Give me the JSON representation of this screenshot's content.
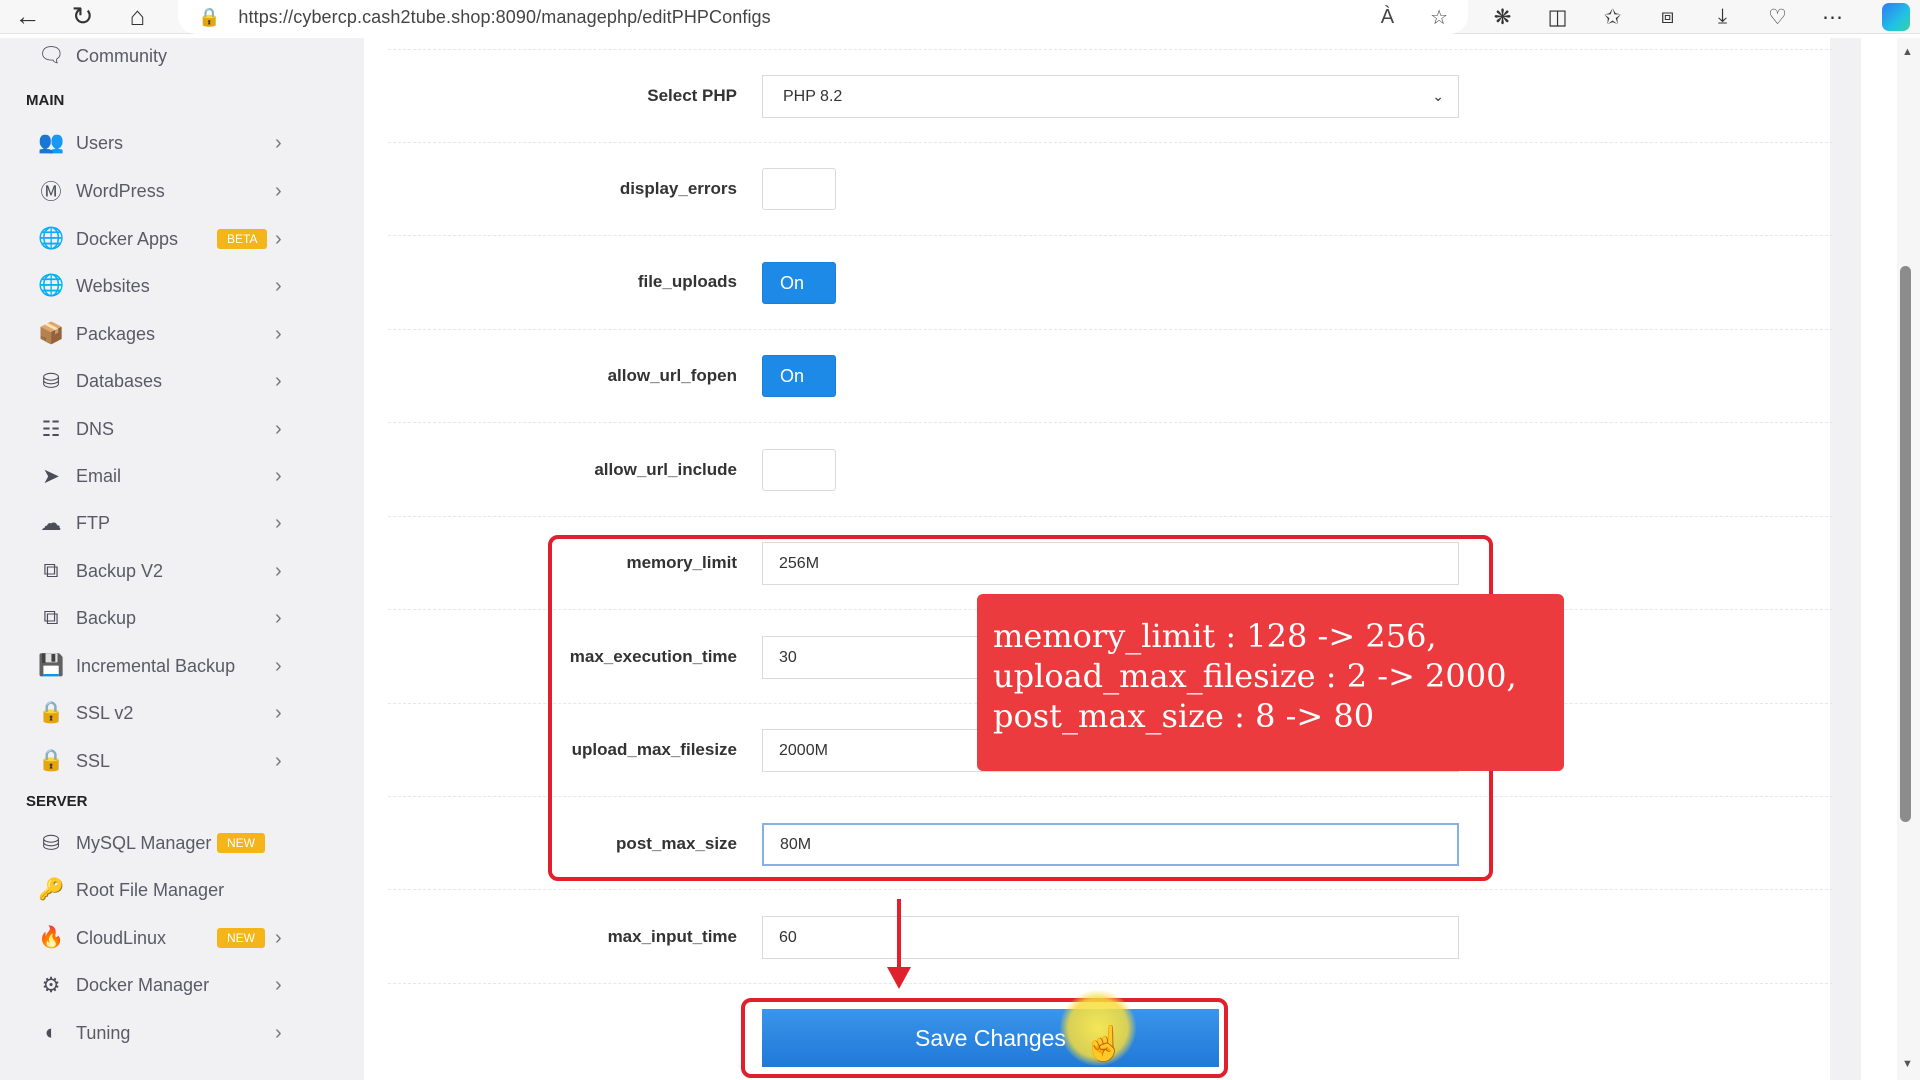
{
  "browser": {
    "url": "https://cybercp.cash2tube.shop:8090/managephp/editPHPConfigs",
    "read_aloud": "À"
  },
  "sidebar": {
    "top_item": "Community",
    "sections": {
      "main": "MAIN",
      "server": "SERVER"
    },
    "items": [
      {
        "label": "Users",
        "icon": "users-icon"
      },
      {
        "label": "WordPress",
        "icon": "wordpress-icon"
      },
      {
        "label": "Docker Apps",
        "icon": "globe-icon",
        "badge": "BETA"
      },
      {
        "label": "Websites",
        "icon": "globe-icon"
      },
      {
        "label": "Packages",
        "icon": "packages-icon"
      },
      {
        "label": "Databases",
        "icon": "database-icon"
      },
      {
        "label": "DNS",
        "icon": "sitemap-icon"
      },
      {
        "label": "Email",
        "icon": "paper-plane-icon"
      },
      {
        "label": "FTP",
        "icon": "cloud-upload-icon"
      },
      {
        "label": "Backup V2",
        "icon": "clone-icon"
      },
      {
        "label": "Backup",
        "icon": "clone-icon"
      },
      {
        "label": "Incremental Backup",
        "icon": "save-icon"
      },
      {
        "label": "SSL v2",
        "icon": "lock-icon"
      },
      {
        "label": "SSL",
        "icon": "lock-icon"
      }
    ],
    "server_items": [
      {
        "label": "MySQL Manager",
        "icon": "database-icon",
        "badge": "NEW"
      },
      {
        "label": "Root File Manager",
        "icon": "key-icon"
      },
      {
        "label": "CloudLinux",
        "icon": "fire-icon",
        "badge": "NEW"
      },
      {
        "label": "Docker Manager",
        "icon": "cogs-icon"
      },
      {
        "label": "Tuning",
        "icon": "adjust-icon"
      }
    ]
  },
  "form": {
    "select_php_label": "Select PHP",
    "select_php_value": "PHP 8.2",
    "display_errors_label": "display_errors",
    "file_uploads_label": "file_uploads",
    "file_uploads_value": "On",
    "allow_url_fopen_label": "allow_url_fopen",
    "allow_url_fopen_value": "On",
    "allow_url_include_label": "allow_url_include",
    "memory_limit_label": "memory_limit",
    "memory_limit_value": "256M",
    "max_execution_time_label": "max_execution_time",
    "max_execution_time_value": "30",
    "upload_max_filesize_label": "upload_max_filesize",
    "upload_max_filesize_value": "2000M",
    "post_max_size_label": "post_max_size",
    "post_max_size_value": "80M",
    "max_input_time_label": "max_input_time",
    "max_input_time_value": "60",
    "save_label": "Save Changes"
  },
  "callout": {
    "line1": "memory_limit : 128 -> 256,",
    "line2": "upload_max_filesize : 2 -> 2000,",
    "line3": "post_max_size : 8 -> 80"
  },
  "colors": {
    "primary": "#1e8ae8",
    "annotation_red": "#e0202d",
    "callout_red": "#ec3b3e",
    "badge_yellow": "#f4b51a"
  }
}
